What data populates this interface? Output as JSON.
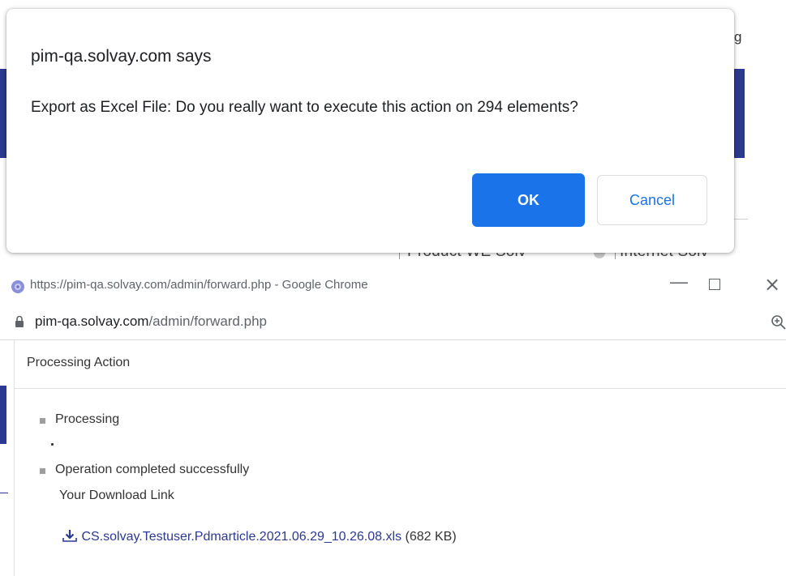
{
  "background": {
    "partial_letter": "g",
    "tabs": [
      "Product WE Solv",
      "Internet Solv"
    ]
  },
  "alert": {
    "title": "pim-qa.solvay.com says",
    "message": "Export as Excel File: Do you really want to execute this action on 294 elements?",
    "ok_label": "OK",
    "cancel_label": "Cancel"
  },
  "popup": {
    "window_title": "https://pim-qa.solvay.com/admin/forward.php - Google Chrome",
    "url_domain": "pim-qa.solvay.com",
    "url_path": "/admin/forward.php",
    "icons": [
      "globe-icon",
      "minimize-icon",
      "maximize-icon",
      "close-icon",
      "lock-icon",
      "zoom-icon"
    ],
    "processing_header": "Processing Action",
    "items": {
      "processing": "Processing",
      "completed": "Operation completed successfully",
      "download_label": "Your Download Link",
      "download_file": "CS.solvay.Testuser.Pdmarticle.2021.06.29_10.26.08.xls",
      "download_size": "(682 KB)"
    }
  },
  "colors": {
    "accent_blue": "#1a73e8",
    "brand_navy": "#2b3990"
  }
}
